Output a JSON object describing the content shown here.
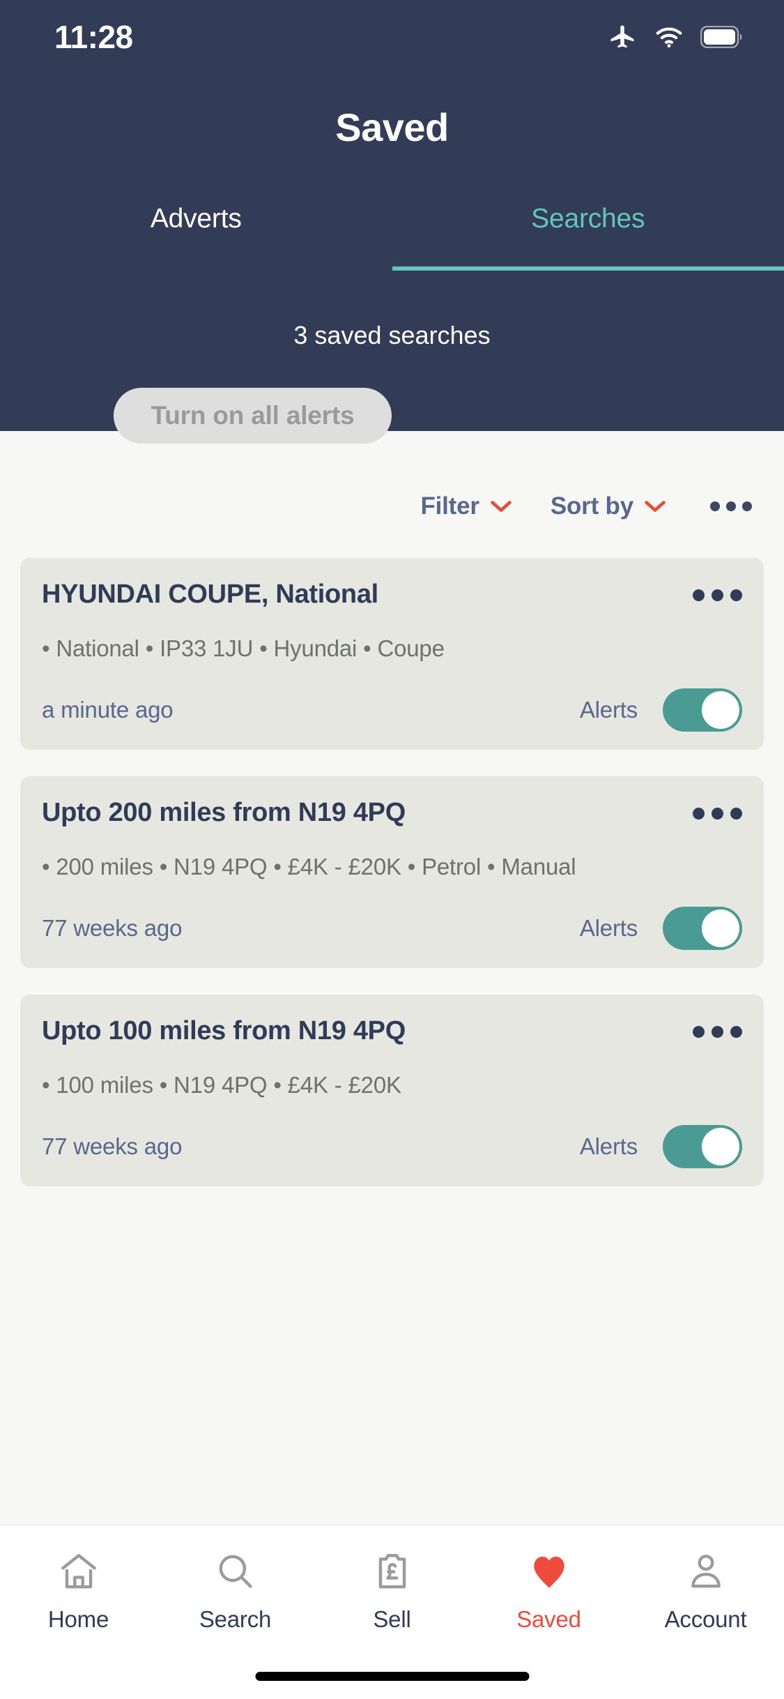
{
  "status_bar": {
    "time": "11:28",
    "icons": [
      "airplane-mode-icon",
      "wifi-icon",
      "battery-icon"
    ]
  },
  "header": {
    "title": "Saved",
    "tabs": [
      {
        "label": "Adverts",
        "active": false
      },
      {
        "label": "Searches",
        "active": true
      }
    ],
    "saved_count_text": "3 saved searches",
    "alerts_button_label": "Turn on all alerts",
    "background_color": "#333C56",
    "accent_color": "#63C6BB"
  },
  "controls": {
    "filter_label": "Filter",
    "sort_label": "Sort by",
    "more_icon": "ellipsis-icon",
    "chevron_color": "#E24C38",
    "text_color": "#5A678C"
  },
  "saved_searches": [
    {
      "title": "HYUNDAI COUPE, National",
      "criteria": "• National • IP33 1JU • Hyundai • Coupe",
      "timestamp": "a minute ago",
      "alerts_label": "Alerts",
      "alerts_on": true
    },
    {
      "title": "Upto 200 miles from N19 4PQ",
      "criteria": "• 200 miles • N19 4PQ • £4K - £20K • Petrol • Manual",
      "timestamp": "77 weeks ago",
      "alerts_label": "Alerts",
      "alerts_on": true
    },
    {
      "title": "Upto 100 miles from N19 4PQ",
      "criteria": "• 100 miles • N19 4PQ • £4K - £20K",
      "timestamp": "77 weeks ago",
      "alerts_label": "Alerts",
      "alerts_on": true
    }
  ],
  "bottom_nav": {
    "items": [
      {
        "label": "Home",
        "icon": "home-icon",
        "active": false
      },
      {
        "label": "Search",
        "icon": "search-icon",
        "active": false
      },
      {
        "label": "Sell",
        "icon": "sell-clipboard-pound-icon",
        "active": false
      },
      {
        "label": "Saved",
        "icon": "heart-icon",
        "active": true
      },
      {
        "label": "Account",
        "icon": "person-icon",
        "active": false
      }
    ],
    "active_color": "#EE4B3C",
    "inactive_color": "#2F3B57"
  },
  "colors": {
    "toggle_on": "#4A9B94",
    "card_bg": "#E6E7E1",
    "page_bg": "#F7F7F5"
  }
}
